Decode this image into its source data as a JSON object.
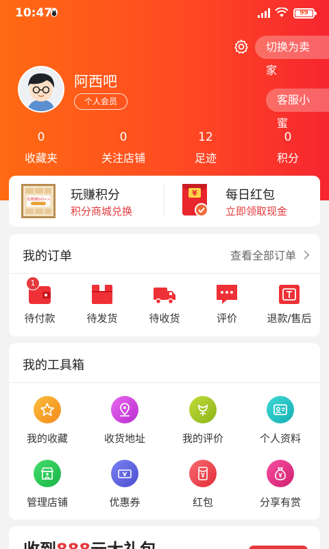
{
  "status_bar": {
    "time": "10:47",
    "battery": "99"
  },
  "header": {
    "switch_seller": "切换为卖家",
    "customer_service": "客服小蜜",
    "username": "阿西吧",
    "member_level": "个人会员"
  },
  "stats": [
    {
      "value": "0",
      "label": "收藏夹"
    },
    {
      "value": "0",
      "label": "关注店铺"
    },
    {
      "value": "12",
      "label": "足迹"
    },
    {
      "value": "0",
      "label": "积分"
    }
  ],
  "promo": {
    "points": {
      "title": "玩赚积分",
      "subtitle": "积分商城兑换",
      "thumb_text": "兑商城GO>>"
    },
    "redpacket": {
      "title": "每日红包",
      "subtitle": "立即领取现金",
      "symbol": "¥"
    }
  },
  "orders": {
    "title": "我的订单",
    "view_all": "查看全部订单",
    "items": [
      {
        "label": "待付款",
        "icon": "wallet-icon",
        "badge": "1"
      },
      {
        "label": "待发货",
        "icon": "package-icon"
      },
      {
        "label": "待收货",
        "icon": "truck-icon"
      },
      {
        "label": "评价",
        "icon": "comment-icon"
      },
      {
        "label": "退款/售后",
        "icon": "refund-icon"
      }
    ]
  },
  "toolbox": {
    "title": "我的工具箱",
    "items": [
      {
        "label": "我的收藏",
        "icon": "star-icon",
        "color": "#f9a72a"
      },
      {
        "label": "收货地址",
        "icon": "location-icon",
        "color": "#d64be0"
      },
      {
        "label": "我的评价",
        "icon": "flower-icon",
        "color": "#a6cc24"
      },
      {
        "label": "个人资料",
        "icon": "profile-card-icon",
        "color": "#22c6c6"
      },
      {
        "label": "管理店铺",
        "icon": "store-icon",
        "color": "#2fc95a"
      },
      {
        "label": "优惠券",
        "icon": "coupon-icon",
        "color": "#5b63e0"
      },
      {
        "label": "红包",
        "icon": "red-envelope-icon",
        "color": "#f0454e"
      },
      {
        "label": "分享有赏",
        "icon": "money-bag-icon",
        "color": "#ec2f86"
      }
    ]
  },
  "bottom_banner": {
    "prefix": "收到",
    "highlight": "888",
    "suffix": "元大礼包"
  },
  "colors": {
    "accent_red": "#e4393c",
    "header_orange": "#ff6a12"
  }
}
